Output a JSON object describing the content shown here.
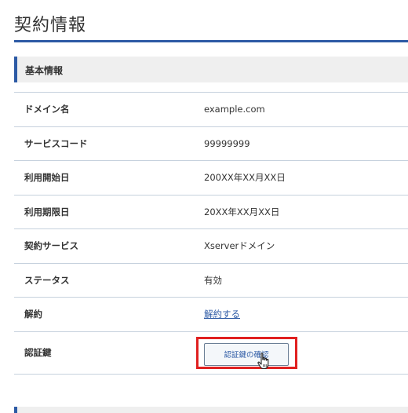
{
  "page": {
    "title": "契約情報"
  },
  "section": {
    "header": "基本情報"
  },
  "rows": [
    {
      "label": "ドメイン名",
      "value": "example.com"
    },
    {
      "label": "サービスコード",
      "value": "99999999"
    },
    {
      "label": "利用開始日",
      "value": "200XX年XX月XX日"
    },
    {
      "label": "利用期限日",
      "value": "20XX年XX月XX日"
    },
    {
      "label": "契約サービス",
      "value": "Xserverドメイン"
    },
    {
      "label": "ステータス",
      "value": "有効"
    },
    {
      "label": "解約",
      "value": "解約する"
    },
    {
      "label": "認証鍵",
      "button_label": "認証鍵の確認"
    }
  ],
  "colors": {
    "accent": "#2d5aa5",
    "highlight": "#e02020",
    "row_border": "#c6d1dd",
    "header_bg": "#efefef"
  },
  "icons": {
    "cursor": "hand-pointer-icon"
  }
}
